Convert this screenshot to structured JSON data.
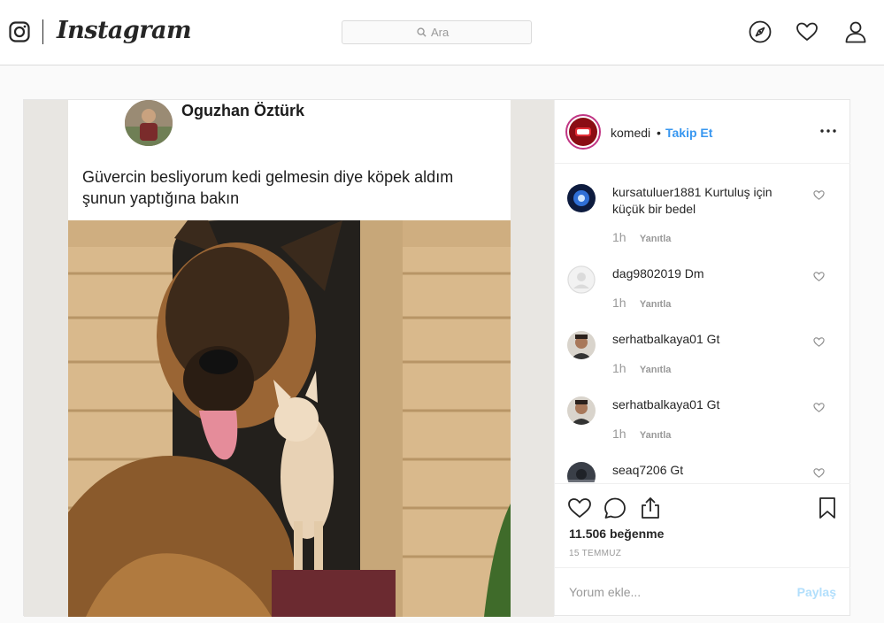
{
  "nav": {
    "wordmark": "Instagram",
    "search_placeholder": "Ara",
    "icons": [
      "instagram-glyph-icon",
      "search-icon",
      "explore-compass-icon",
      "activity-heart-icon",
      "profile-icon"
    ]
  },
  "post": {
    "media": {
      "meme_author": "Oguzhan Öztürk",
      "meme_text": "Güvercin besliyorum kedi gelmesin diye köpek aldım şunun yaptığına bakın"
    },
    "author": {
      "username": "komedi",
      "separator": "•",
      "follow_label": "Takip Et"
    },
    "comments": [
      {
        "username": "kursatuluer1881",
        "text": "Kurtuluş için küçük bir bedel",
        "time": "1h",
        "reply_label": "Yanıtla"
      },
      {
        "username": "dag9802019",
        "text": "Dm",
        "time": "1h",
        "reply_label": "Yanıtla"
      },
      {
        "username": "serhatbalkaya01",
        "text": "Gt",
        "time": "1h",
        "reply_label": "Yanıtla"
      },
      {
        "username": "serhatbalkaya01",
        "text": "Gt",
        "time": "1h",
        "reply_label": "Yanıtla"
      },
      {
        "username": "seaq7206",
        "text": "Gt",
        "time": "",
        "reply_label": ""
      }
    ],
    "likes": "11.506 beğenme",
    "date": "15 TEMMUZ",
    "comment_placeholder": "Yorum ekle...",
    "share_label": "Paylaş"
  },
  "colors": {
    "accent_blue": "#3897f0",
    "disabled_blue": "#b2dffc",
    "text": "#262626",
    "muted": "#999999",
    "border": "#dbdbdb"
  }
}
